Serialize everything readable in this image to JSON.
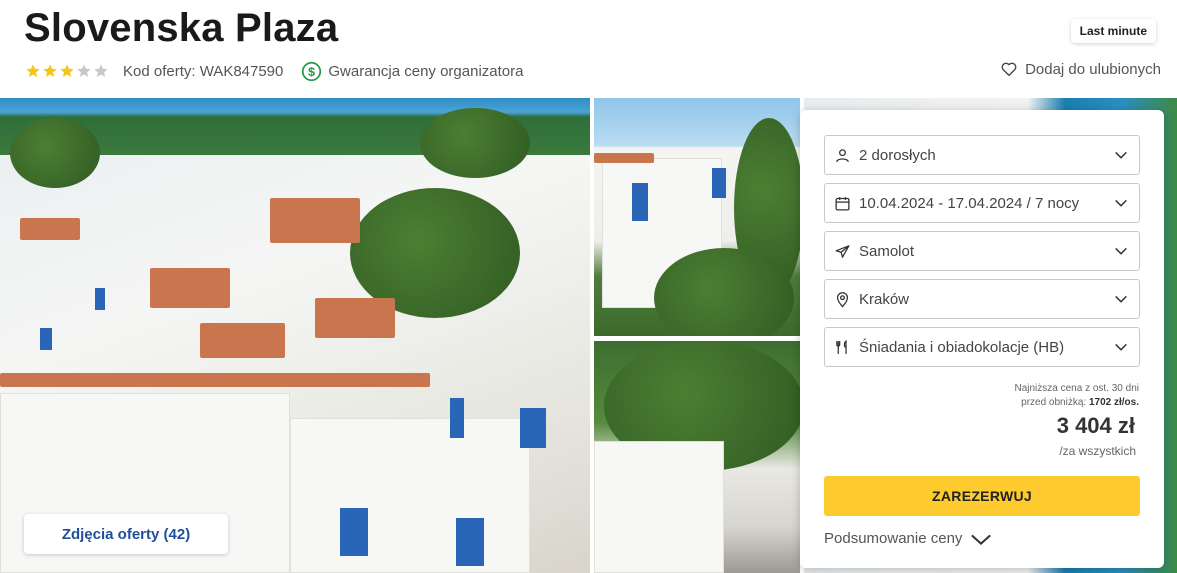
{
  "header": {
    "title": "Slovenska Plaza",
    "badge": "Last minute",
    "rating_stars": 3,
    "rating_max": 5,
    "offer_code": "Kod oferty: WAK847590",
    "guarantee": "Gwarancja ceny organizatora",
    "favorite": "Dodaj do ulubionych"
  },
  "gallery": {
    "photos_button": "Zdjęcia oferty (42)"
  },
  "booking": {
    "guests": "2 dorosłych",
    "dates": "10.04.2024 - 17.04.2024 / 7 nocy",
    "transport": "Samolot",
    "departure": "Kraków",
    "board": "Śniadania i obiadokolacje (HB)",
    "lowest_price_line1": "Najniższa cena z ost. 30 dni",
    "lowest_price_line2": "przed obniżką: ",
    "lowest_price_value": "1702 zł/os.",
    "price": "3 404 zł",
    "price_sub": "/za wszystkich",
    "book_label": "ZAREZERWUJ",
    "summary_label": "Podsumowanie ceny"
  },
  "colors": {
    "star_filled": "#f5c518",
    "star_empty": "#c8c8c8",
    "accent_yellow": "#fdcb2e",
    "link_blue": "#1e4f9c",
    "guarantee_green": "#1d9b4a"
  }
}
